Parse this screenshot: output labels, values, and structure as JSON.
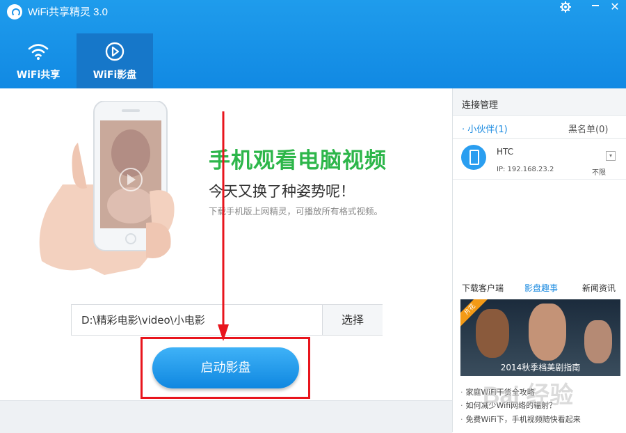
{
  "app": {
    "title": "WiFi共享精灵 3.0"
  },
  "window_controls": {
    "settings_icon": "gear-icon",
    "close_glyph": "✕"
  },
  "tabs": [
    {
      "label": "WiFi共享",
      "icon": "wifi-icon"
    },
    {
      "label": "WiFi影盘",
      "icon": "play-circle-icon",
      "active": true
    }
  ],
  "hero": {
    "title": "手机观看电脑视频",
    "subtitle": "今天又换了种姿势呢！",
    "description": "下载手机版上网精灵，可播放所有格式视频。"
  },
  "path": {
    "value": "D:\\精彩电影\\video\\小电影",
    "choose_label": "选择"
  },
  "start_button": {
    "label": "启动影盘"
  },
  "sidebar": {
    "header": "连接管理",
    "friend_tabs": [
      {
        "label": "小伙伴(1)",
        "active": true
      },
      {
        "label": "黑名单(0)"
      }
    ],
    "device": {
      "name": "HTC",
      "ip": "IP: 192.168.23.2",
      "limit": "不限"
    },
    "news_tabs": [
      {
        "label": "下载客户端"
      },
      {
        "label": "影盘趣事",
        "active": true
      },
      {
        "label": "新闻资讯"
      }
    ],
    "banner": {
      "ribbon": "片花",
      "caption": "2014秋季档美剧指南"
    },
    "news": [
      "家庭WiFi干货全攻略",
      "如何减少Wifi网络的辐射？",
      "免费WiFi下，手机视频随快看起来"
    ]
  },
  "watermark": "Bai 经验",
  "colors": {
    "header": "#1592e6",
    "green_title": "#2db64a",
    "accent_blue": "#1a8ae0",
    "annotation_red": "#e8151d"
  }
}
